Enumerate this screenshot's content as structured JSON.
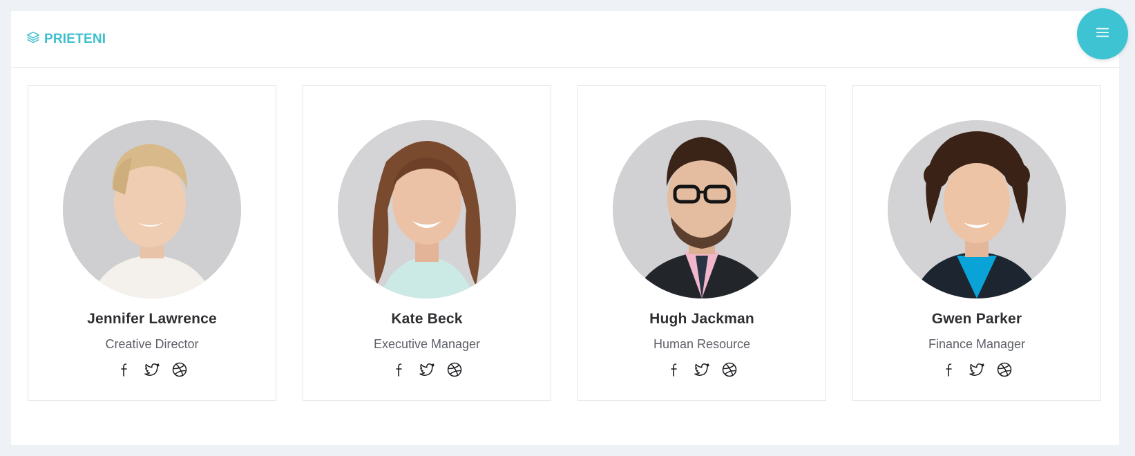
{
  "header": {
    "title": "PRIETENI",
    "title_icon": "layers-icon",
    "menu_icon": "hamburger-menu-icon",
    "accent_color": "#3ebfce"
  },
  "friends": [
    {
      "name": "Jennifer Lawrence",
      "role": "Creative Director",
      "socials": [
        "facebook-icon",
        "twitter-icon",
        "dribbble-icon"
      ]
    },
    {
      "name": "Kate Beck",
      "role": "Executive Manager",
      "socials": [
        "facebook-icon",
        "twitter-icon",
        "dribbble-icon"
      ]
    },
    {
      "name": "Hugh Jackman",
      "role": "Human Resource",
      "socials": [
        "facebook-icon",
        "twitter-icon",
        "dribbble-icon"
      ]
    },
    {
      "name": "Gwen Parker",
      "role": "Finance Manager",
      "socials": [
        "facebook-icon",
        "twitter-icon",
        "dribbble-icon"
      ]
    }
  ]
}
